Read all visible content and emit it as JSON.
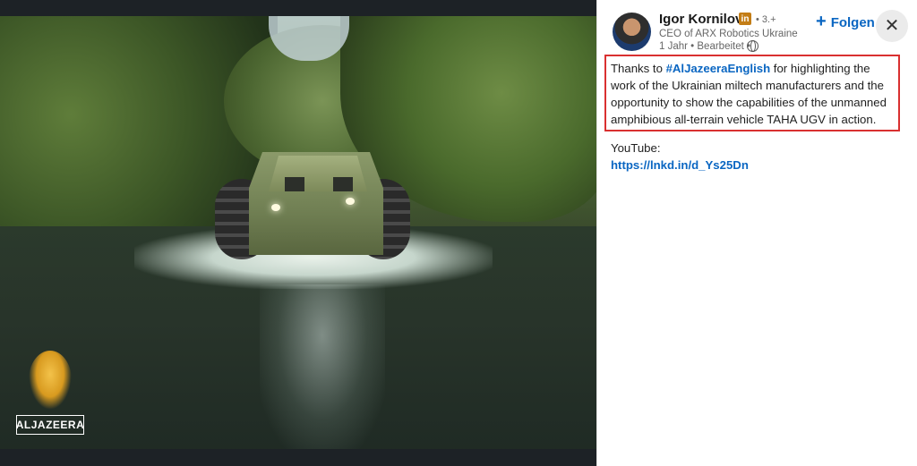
{
  "media": {
    "logo_text": "ALJAZEERA",
    "logo_icon": "aljazeera-logo-icon"
  },
  "post": {
    "author_name": "Igor Kornilov",
    "badge_label": "in",
    "connection_degree": "• 3.+",
    "headline": "CEO of ARX Robotics Ukraine",
    "meta": "1 Jahr • Bearbeitet •",
    "follow_label": "Folgen",
    "text_before": "Thanks to ",
    "hashtag": "#AlJazeeraEnglish",
    "text_after": " for highlighting the work of the Ukrainian miltech manufacturers and the opportunity to show the capabilities of the unmanned amphibious all-terrain vehicle TAHA UGV in action.",
    "youtube_label": "YouTube:",
    "youtube_link": "https://lnkd.in/d_Ys25Dn"
  },
  "icons": {
    "follow": "plus-icon",
    "close": "close-icon",
    "visibility": "globe-icon",
    "linkedin": "linkedin-badge-icon"
  },
  "colors": {
    "link": "#0a66c2",
    "highlight_border": "#d93030",
    "badge": "#c37d16"
  }
}
